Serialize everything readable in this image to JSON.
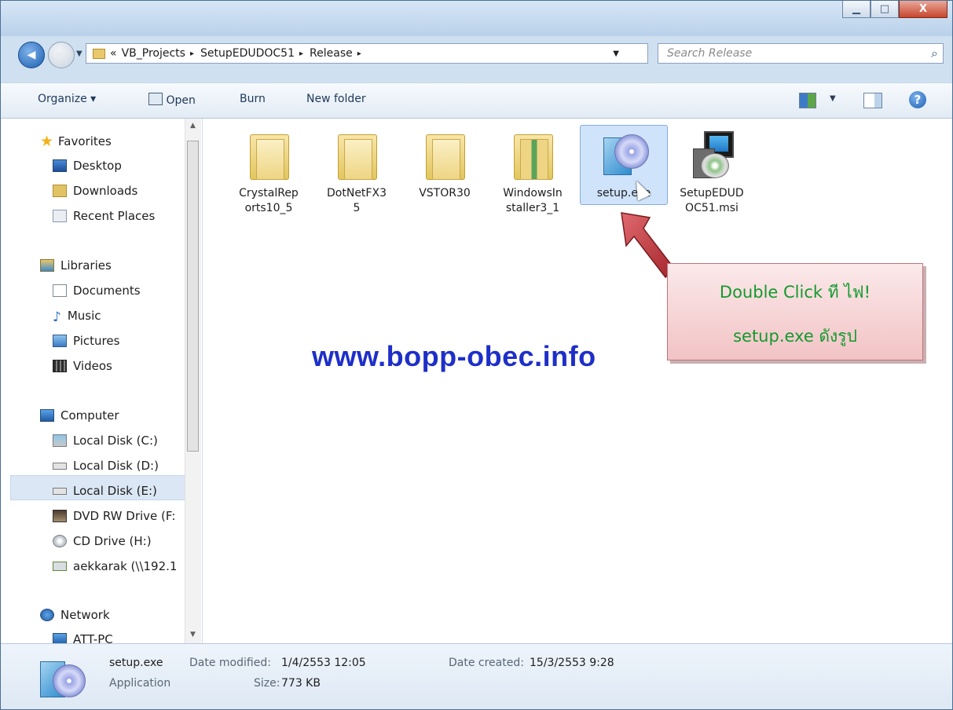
{
  "window": {
    "controls": {
      "minimize": "▁",
      "maximize": "□",
      "close": "X"
    }
  },
  "nav": {
    "back_glyph": "◀",
    "forward_glyph": "▶",
    "recent_glyph": "▼"
  },
  "address": {
    "overflow_glyph": "«",
    "breadcrumbs": [
      "VB_Projects",
      "SetupEDUDOC51",
      "Release"
    ],
    "separator": "▸",
    "dropdown_glyph": "▼",
    "refresh_glyph": "↻"
  },
  "search": {
    "placeholder": "Search Release",
    "icon": "search-icon"
  },
  "toolbar": {
    "organize": "Organize ▾",
    "open": "Open",
    "burn": "Burn",
    "new_folder": "New folder",
    "views_dropdown": "▼",
    "help": "?"
  },
  "sidebar": {
    "favorites_header": "Favorites",
    "favorites": [
      "Desktop",
      "Downloads",
      "Recent Places"
    ],
    "libraries_header": "Libraries",
    "libraries": [
      "Documents",
      "Music",
      "Pictures",
      "Videos"
    ],
    "computer_header": "Computer",
    "computer": [
      "Local Disk (C:)",
      "Local Disk (D:)",
      "Local Disk (E:)",
      "DVD RW Drive (F:",
      "CD Drive (H:)",
      "aekkarak (\\\\192.1"
    ],
    "network_header": "Network",
    "network": [
      "ATT-PC"
    ],
    "selected": "Local Disk (E:)"
  },
  "files": [
    {
      "line1": "CrystalRep",
      "line2": "orts10_5",
      "type": "folder"
    },
    {
      "line1": "DotNetFX3",
      "line2": "5",
      "type": "folder"
    },
    {
      "line1": "VSTOR30",
      "line2": "",
      "type": "folder"
    },
    {
      "line1": "WindowsIn",
      "line2": "staller3_1",
      "type": "folder"
    },
    {
      "line1": "setup.exe",
      "line2": "",
      "type": "setup-exe",
      "selected": true
    },
    {
      "line1": "SetupEDUD",
      "line2": "OC51.msi",
      "type": "msi"
    }
  ],
  "callout": {
    "line1": "Double Click ที  ไฟ!",
    "line2": "setup.exe ดังรูป"
  },
  "watermark": "www.bopp-obec.info",
  "status": {
    "filename": "setup.exe",
    "type": "Application",
    "modified_label": "Date modified:",
    "modified_value": "1/4/2553 12:05",
    "size_label": "Size:",
    "size_value": "773 KB",
    "created_label": "Date created:",
    "created_value": "15/3/2553 9:28"
  },
  "colors": {
    "watermark": "#1e2fc9",
    "callout_text": "#129a2e",
    "arrow": "#c0363d",
    "selection": "#cfe3fb"
  }
}
